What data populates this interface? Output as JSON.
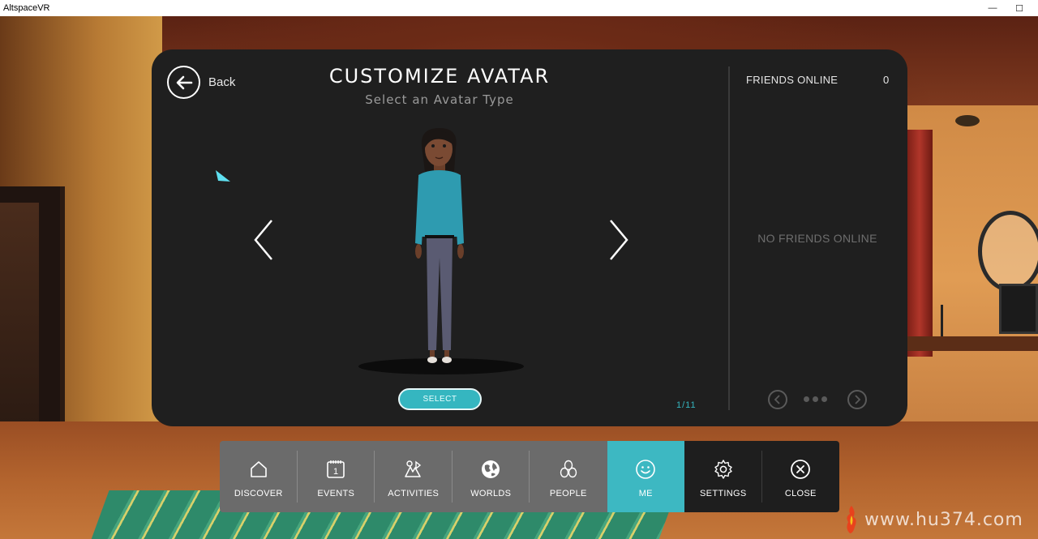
{
  "window": {
    "title": "AltspaceVR",
    "minimize": "—",
    "maximize": "☐"
  },
  "header": {
    "back_label": "Back",
    "title": "CUSTOMIZE AVATAR",
    "subtitle": "Select an Avatar Type"
  },
  "carousel": {
    "select_label": "SELECT",
    "page_counter": "1/11",
    "current_index": 1,
    "total": 11
  },
  "friends": {
    "title": "FRIENDS ONLINE",
    "count": "0",
    "empty_message": "NO FRIENDS ONLINE"
  },
  "nav": {
    "items": [
      {
        "label": "DISCOVER",
        "icon": "home-icon"
      },
      {
        "label": "EVENTS",
        "icon": "calendar-icon"
      },
      {
        "label": "ACTIVITIES",
        "icon": "activities-icon"
      },
      {
        "label": "WORLDS",
        "icon": "globe-icon"
      },
      {
        "label": "PEOPLE",
        "icon": "people-icon"
      },
      {
        "label": "ME",
        "icon": "smiley-icon",
        "active": true
      },
      {
        "label": "SETTINGS",
        "icon": "gear-icon"
      },
      {
        "label": "CLOSE",
        "icon": "close-circle-icon"
      }
    ],
    "events_badge": "1"
  },
  "watermark": {
    "text": "www.hu374.com"
  },
  "colors": {
    "accent": "#3db8c2",
    "panel": "#1f1f1f",
    "nav_grey": "#6b6b6b",
    "nav_dark": "#1e1e1e"
  }
}
